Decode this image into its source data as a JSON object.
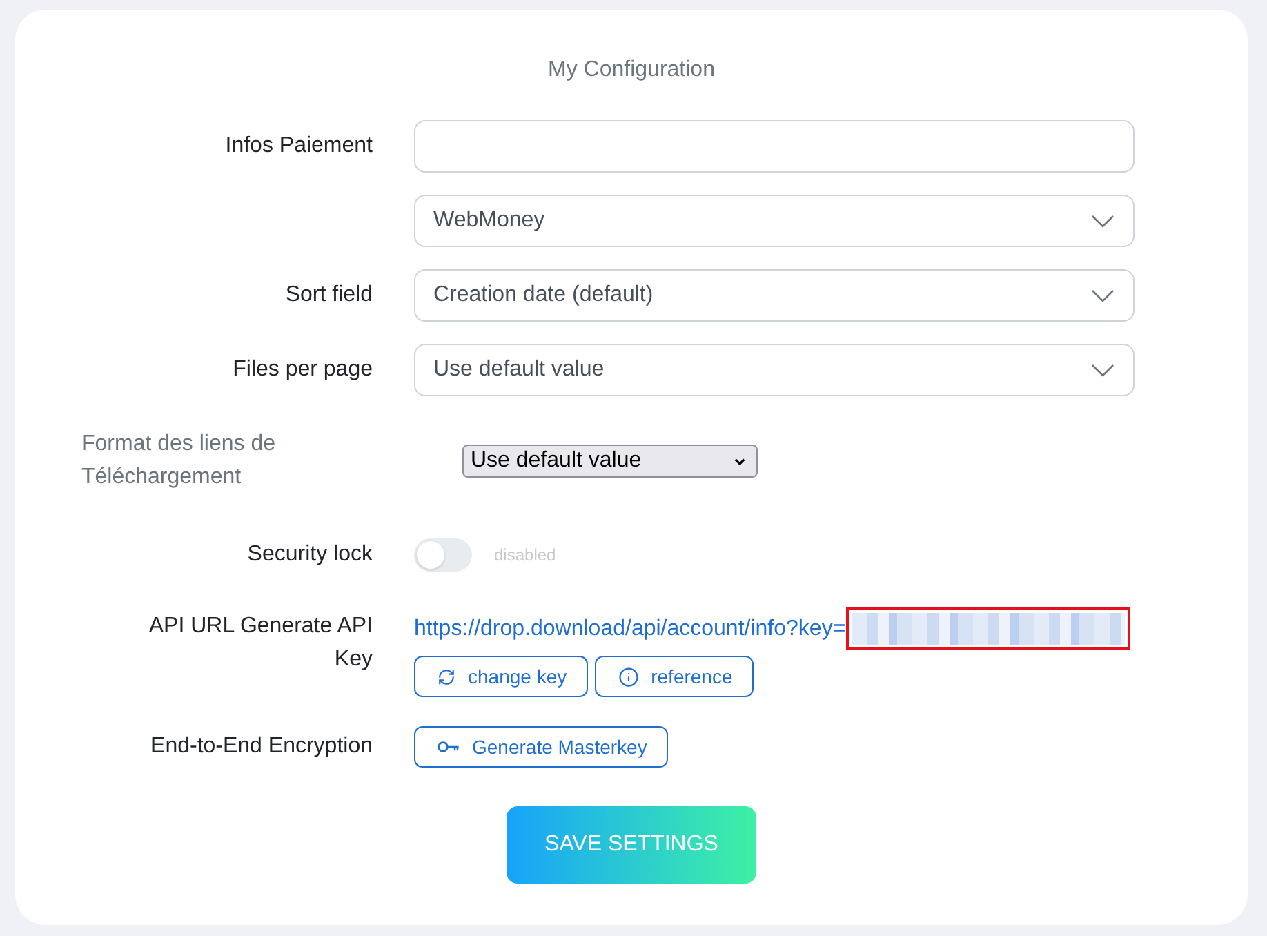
{
  "title": "My Configuration",
  "fields": [
    {
      "kind": "text",
      "label": "Infos Paiement"
    },
    {
      "kind": "select",
      "value": "WebMoney"
    },
    {
      "kind": "select",
      "label": "Sort field",
      "value": "Creation date (default)"
    },
    {
      "kind": "select",
      "label": "Files per page",
      "value": "Use default value"
    }
  ],
  "link_format": {
    "label": "Format des liens de Téléchargement",
    "value": "Use default value"
  },
  "security_lock": {
    "label": "Security lock",
    "on": false,
    "status": "disabled"
  },
  "api": {
    "label": "API URL Generate API Key",
    "url": "https://drop.download/api/account/info?key=",
    "key": {
      "redacted": true,
      "highlighted": true
    },
    "buttons": [
      {
        "kind": "refresh",
        "label": "change key"
      },
      {
        "kind": "info",
        "label": "reference"
      }
    ]
  },
  "encryption": {
    "label": "End-to-End Encryption",
    "button": {
      "kind": "key",
      "label": "Generate Masterkey"
    }
  },
  "save_button": "SAVE SETTINGS"
}
